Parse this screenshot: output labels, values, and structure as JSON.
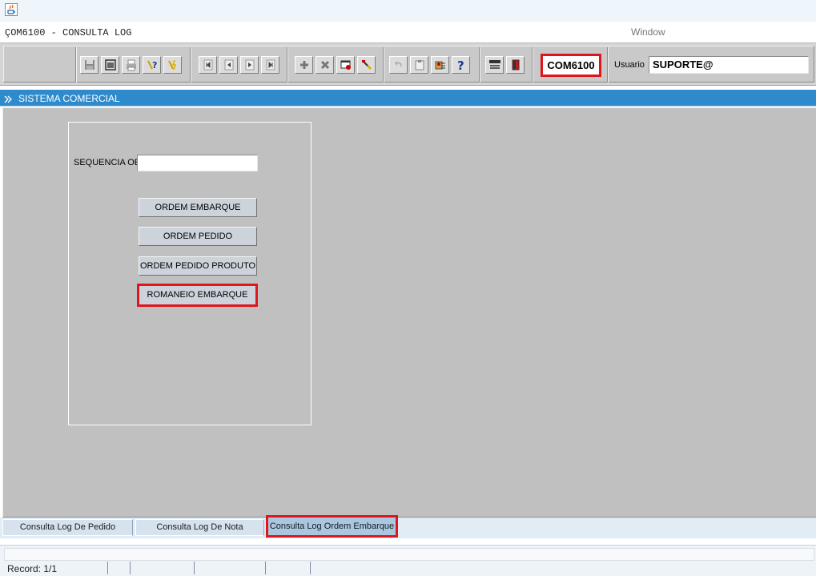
{
  "window": {
    "form_title": "ÇOM6100 - CONSULTA LOG",
    "menu": [
      "Window"
    ]
  },
  "toolbar": {
    "groups": [
      [
        "save-icon",
        "window-icon",
        "print-icon",
        "query-help-icon",
        "execute-query-icon"
      ],
      [
        "first-record-icon",
        "previous-record-icon",
        "next-record-icon",
        "last-record-icon"
      ],
      [
        "insert-record-icon",
        "delete-record-icon",
        "edit-record-icon",
        "clear-record-icon"
      ],
      [
        "undo-icon",
        "clipboard-icon",
        "list-values-icon",
        "help-icon"
      ],
      [
        "menu-icon",
        "exit-icon"
      ]
    ],
    "form_code": "COM6100",
    "usuario_label": "Usuario",
    "usuario_value": "SUPORTE@"
  },
  "section": {
    "title": "SISTEMA COMERCIAL"
  },
  "form": {
    "sequencia_label": "SEQUENCIA OE",
    "sequencia_value": "",
    "buttons": [
      "ORDEM EMBARQUE",
      "ORDEM PEDIDO",
      "ORDEM PEDIDO PRODUTO",
      "ROMANEIO EMBARQUE"
    ]
  },
  "tabs": [
    "Consulta Log De Pedido",
    "Consulta Log De Nota",
    "Consulta Log Ordem Embarque"
  ],
  "active_tab": "Consulta Log Ordem Embarque",
  "status": {
    "record": "Record: 1/1"
  },
  "colors": {
    "highlight": "#e0161d",
    "section_bar": "#2f8acb",
    "canvas": "#c0c0c0"
  }
}
